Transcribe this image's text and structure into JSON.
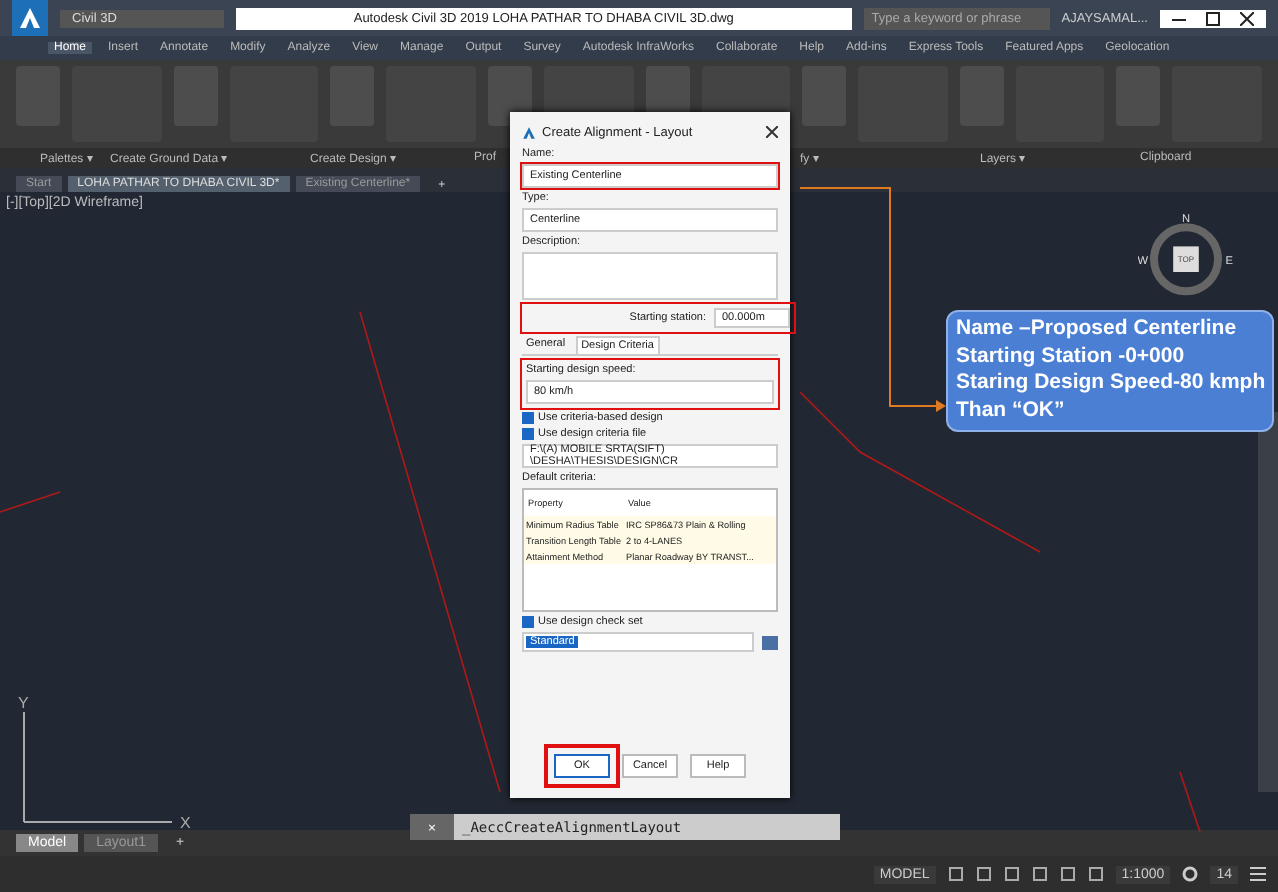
{
  "window": {
    "title": "Autodesk Civil 3D 2019    LOHA PATHAR TO DHABA CIVIL 3D.dwg",
    "workspace": "Civil 3D",
    "search_placeholder": "Type a keyword or phrase",
    "user": "AJAYSAMAL..."
  },
  "ribbon_tabs": [
    {
      "label": "Home",
      "selected": true
    },
    {
      "label": "Insert",
      "selected": false
    },
    {
      "label": "Annotate",
      "selected": false
    },
    {
      "label": "Modify",
      "selected": false
    },
    {
      "label": "Analyze",
      "selected": false
    },
    {
      "label": "View",
      "selected": false
    },
    {
      "label": "Manage",
      "selected": false
    },
    {
      "label": "Output",
      "selected": false
    },
    {
      "label": "Survey",
      "selected": false
    },
    {
      "label": "Autodesk InfraWorks",
      "selected": false
    },
    {
      "label": "Collaborate",
      "selected": false
    },
    {
      "label": "Help",
      "selected": false
    },
    {
      "label": "Add-ins",
      "selected": false
    },
    {
      "label": "Express Tools",
      "selected": false
    },
    {
      "label": "Featured Apps",
      "selected": false
    },
    {
      "label": "Geolocation",
      "selected": false
    }
  ],
  "panels": [
    "Palettes ▾",
    "Create Ground Data ▾",
    "Create Design ▾",
    "Prof",
    "fy ▾",
    "Layers ▾",
    "Clipboard"
  ],
  "doc_tabs": [
    {
      "label": "Start",
      "selected": false
    },
    {
      "label": "LOHA PATHAR TO DHABA CIVIL 3D*",
      "selected": true
    },
    {
      "label": "Existing Centerline*",
      "selected": false
    }
  ],
  "viewport": {
    "label": "[-][Top][2D Wireframe]",
    "compass": [
      "N",
      "W",
      "E"
    ],
    "cube_face": "TOP",
    "axis_x": "X",
    "axis_y": "Y"
  },
  "dialog": {
    "title": "Create Alignment - Layout",
    "name_label": "Name:",
    "name_value": "Existing Centerline",
    "type_label": "Type:",
    "type_value": "Centerline",
    "description_label": "Description:",
    "station_label": "Starting station:",
    "station_value": "00.000m",
    "tabs": [
      {
        "label": "General",
        "selected": false
      },
      {
        "label": "Design Criteria",
        "selected": true
      }
    ],
    "speed_label": "Starting design speed:",
    "speed_value": "80 km/h",
    "options": [
      {
        "label": "Use criteria-based design",
        "checked": true
      },
      {
        "label": "Use design criteria file",
        "checked": true
      }
    ],
    "file_path": "F:\\(A) MOBILE SRTA(SIFT) \\DESHA\\THESIS\\DESIGN\\CR",
    "default_criteria_label": "Default criteria:",
    "criteria_columns": [
      "Property",
      "Value"
    ],
    "criteria_rows": [
      [
        "Minimum Radius Table",
        "IRC SP86&73 Plain & Rolling"
      ],
      [
        "Transition Length Table",
        "2 to 4-LANES"
      ],
      [
        "Attainment Method",
        "Planar Roadway BY TRANST..."
      ]
    ],
    "check_set": {
      "label": "Use design check set",
      "checked": true
    },
    "check_set_value": "Standard",
    "buttons": [
      {
        "label": "OK",
        "highlighted": true
      },
      {
        "label": "Cancel",
        "highlighted": false
      },
      {
        "label": "Help",
        "highlighted": false
      }
    ]
  },
  "callout": [
    "Name –Proposed Centerline",
    "Starting Station -0+000",
    "Staring Design Speed-80 kmph",
    "Than “OK”"
  ],
  "command_line": "_AeccCreateAlignmentLayout",
  "command_close": "×",
  "add_tab": "+",
  "layout_tabs": [
    {
      "label": "Model",
      "selected": true
    },
    {
      "label": "Layout1",
      "selected": false
    }
  ],
  "status_bar": {
    "mode": "MODEL",
    "scale": "1:1000",
    "count": "14"
  }
}
